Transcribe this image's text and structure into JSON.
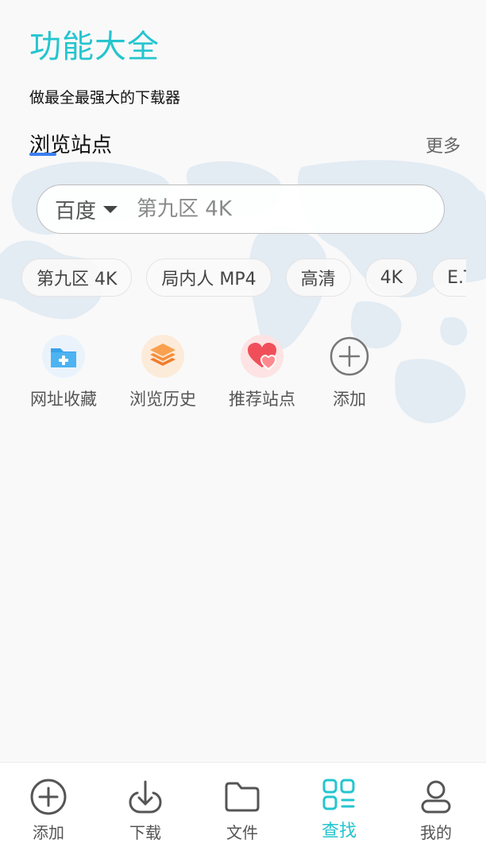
{
  "header": {
    "title": "功能大全",
    "subtitle": "做最全最强大的下载器"
  },
  "section": {
    "title": "浏览站点",
    "more_label": "更多"
  },
  "search": {
    "engine": "百度",
    "placeholder": "第九区 4K"
  },
  "chips": [
    "第九区 4K",
    "局内人 MP4",
    "高清",
    "4K",
    "E.T"
  ],
  "shortcuts": [
    {
      "label": "网址收藏",
      "icon": "bookmark-folder-icon"
    },
    {
      "label": "浏览历史",
      "icon": "history-layers-icon"
    },
    {
      "label": "推荐站点",
      "icon": "heart-icon"
    },
    {
      "label": "添加",
      "icon": "add-circle-icon"
    }
  ],
  "bottom_nav": [
    {
      "label": "添加",
      "icon": "add-circle-icon"
    },
    {
      "label": "下载",
      "icon": "download-icon"
    },
    {
      "label": "文件",
      "icon": "folder-icon"
    },
    {
      "label": "查找",
      "icon": "discover-grid-icon",
      "active": true
    },
    {
      "label": "我的",
      "icon": "user-icon"
    }
  ],
  "colors": {
    "accent": "#25c5cf",
    "underline": "#3b7ff0",
    "text": "#333333",
    "muted": "#666666",
    "background": "#f9f9f9"
  }
}
